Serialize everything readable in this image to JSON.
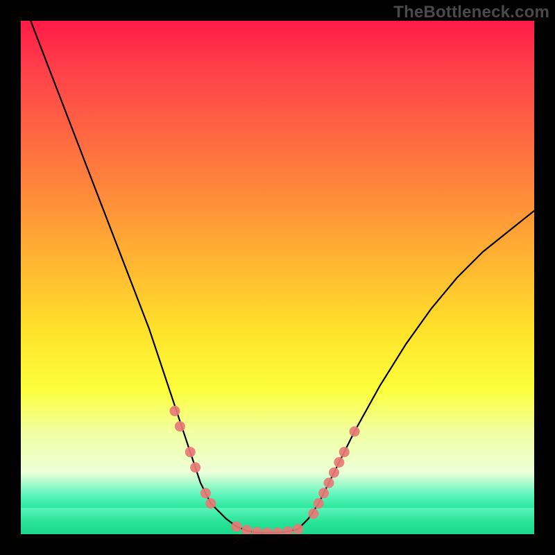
{
  "watermark": "TheBottleneck.com",
  "colors": {
    "gradient_top": "#ff1a47",
    "gradient_mid": "#ffe12a",
    "gradient_bottom": "#1fe08d",
    "curve": "#000000",
    "marker": "#e77a76",
    "frame": "#000000"
  },
  "chart_data": {
    "type": "line",
    "title": "",
    "xlabel": "",
    "ylabel": "",
    "xlim": [
      0,
      100
    ],
    "ylim": [
      0,
      100
    ],
    "x": [
      0,
      5,
      10,
      15,
      20,
      25,
      27,
      29,
      31,
      33,
      35,
      37,
      40,
      42,
      44,
      46,
      48,
      50,
      52,
      54,
      56,
      58,
      60,
      65,
      70,
      75,
      80,
      85,
      90,
      95,
      100
    ],
    "y": [
      105,
      92,
      79,
      66,
      53,
      40,
      34,
      28,
      22,
      16,
      10,
      6,
      3,
      1.5,
      0.7,
      0.3,
      0.3,
      0.3,
      0.5,
      1,
      3,
      6,
      10,
      20,
      29,
      37,
      44,
      50,
      55,
      59,
      63
    ],
    "markers": [
      {
        "x": 30,
        "y": 24
      },
      {
        "x": 31,
        "y": 21
      },
      {
        "x": 33,
        "y": 16
      },
      {
        "x": 34,
        "y": 13
      },
      {
        "x": 36,
        "y": 8
      },
      {
        "x": 37,
        "y": 6
      },
      {
        "x": 42,
        "y": 1.5
      },
      {
        "x": 44,
        "y": 0.8
      },
      {
        "x": 46,
        "y": 0.4
      },
      {
        "x": 48,
        "y": 0.3
      },
      {
        "x": 50,
        "y": 0.3
      },
      {
        "x": 52,
        "y": 0.5
      },
      {
        "x": 54,
        "y": 1
      },
      {
        "x": 57,
        "y": 4
      },
      {
        "x": 58,
        "y": 6
      },
      {
        "x": 59,
        "y": 8
      },
      {
        "x": 60,
        "y": 10
      },
      {
        "x": 61,
        "y": 12
      },
      {
        "x": 62,
        "y": 14
      },
      {
        "x": 63,
        "y": 16
      },
      {
        "x": 65,
        "y": 20
      }
    ]
  }
}
